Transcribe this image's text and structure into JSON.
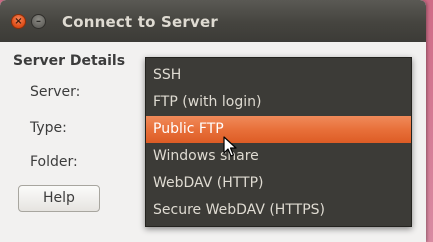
{
  "window": {
    "title": "Connect to Server",
    "close_glyph": "×",
    "minimize_glyph": "–"
  },
  "form": {
    "section_title": "Server Details",
    "server_label": "Server:",
    "type_label": "Type:",
    "folder_label": "Folder:",
    "help_label": "Help"
  },
  "type_dropdown": {
    "selected": "Public FTP",
    "options": [
      {
        "label": "SSH"
      },
      {
        "label": "FTP (with login)"
      },
      {
        "label": "Public FTP"
      },
      {
        "label": "Windows share"
      },
      {
        "label": "WebDAV (HTTP)"
      },
      {
        "label": "Secure WebDAV (HTTPS)"
      }
    ]
  },
  "colors": {
    "accent": "#e8703a",
    "titlebar": "#3c3b37",
    "menu_bg": "#3c3b37",
    "window_bg": "#f2f1f0",
    "desktop": "#cf6b86"
  }
}
